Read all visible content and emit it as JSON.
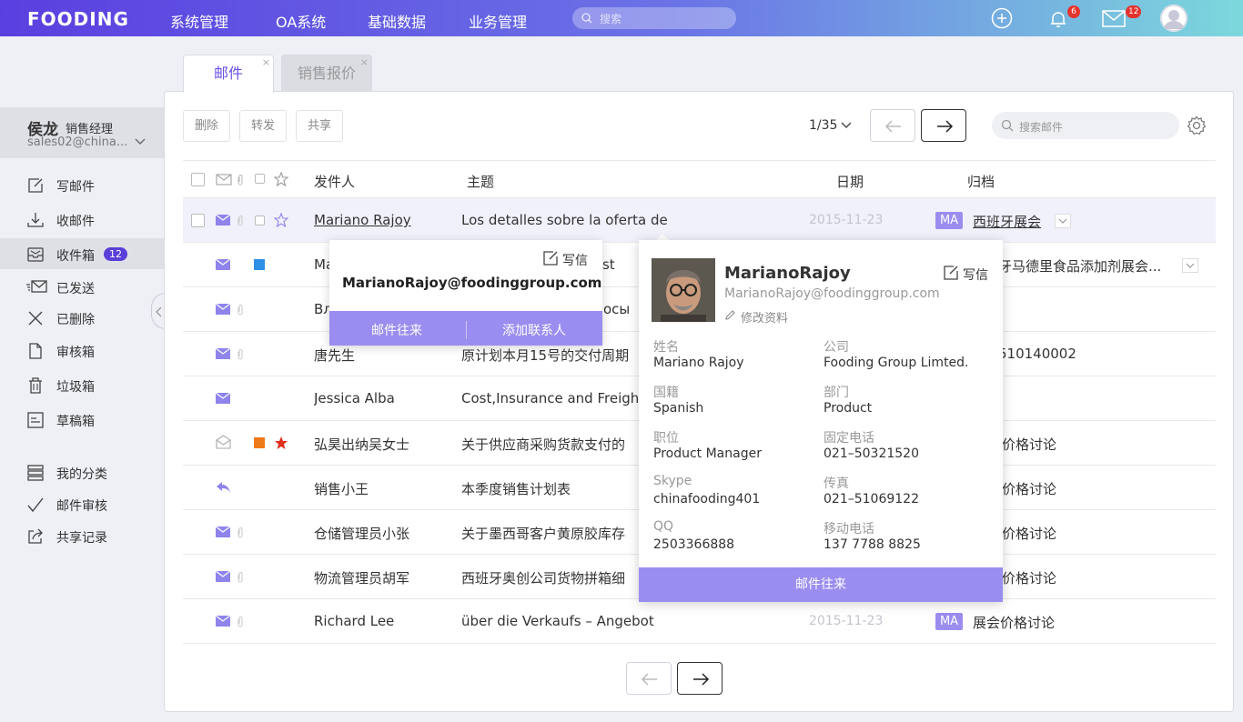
{
  "app": {
    "logo": "FOODING",
    "nav": [
      "系统管理",
      "OA系统",
      "基础数据",
      "业务管理"
    ],
    "search_placeholder": "搜索",
    "notifications_count": "6",
    "mail_count": "12"
  },
  "tabs": [
    {
      "label": "邮件",
      "active": true
    },
    {
      "label": "销售报价",
      "active": false
    }
  ],
  "user": {
    "name": "侯龙",
    "role": "销售经理",
    "email": "sales02@china..."
  },
  "sidebar": {
    "items": [
      {
        "label": "写邮件",
        "icon": "compose-icon"
      },
      {
        "label": "收邮件",
        "icon": "download-icon"
      },
      {
        "label": "收件箱",
        "icon": "inbox-icon",
        "badge": "12"
      },
      {
        "label": "已发送",
        "icon": "sent-icon"
      },
      {
        "label": "已删除",
        "icon": "close-icon"
      },
      {
        "label": "审核箱",
        "icon": "document-icon"
      },
      {
        "label": "垃圾箱",
        "icon": "trash-icon"
      },
      {
        "label": "草稿箱",
        "icon": "draft-icon"
      },
      {
        "label": "我的分类",
        "icon": "stack-icon"
      },
      {
        "label": "邮件审核",
        "icon": "check-icon"
      },
      {
        "label": "共享记录",
        "icon": "share-icon"
      }
    ]
  },
  "toolbar": {
    "delete": "删除",
    "forward": "转发",
    "share": "共享",
    "page": "1/35",
    "search_placeholder": "搜索邮件"
  },
  "table": {
    "headers": {
      "sender": "发件人",
      "subject": "主题",
      "date": "日期",
      "archive": "归档"
    },
    "rows": [
      {
        "sender": "Mariano Rajoy",
        "subject": "Los detalles sobre la oferta de",
        "date": "2015-11-23",
        "tag": "MA",
        "archive": "西班牙展会"
      },
      {
        "sender": "Ma",
        "subject": "cuest",
        "date": "",
        "tag": "",
        "archive": "牙马德里食品添加剂展会..."
      },
      {
        "sender": "Вл",
        "subject": "осы",
        "date": "",
        "tag": "",
        "archive": ""
      },
      {
        "sender": "唐先生",
        "subject": "原计划本月15号的交付周期",
        "date": "",
        "tag": "",
        "archive": "510140002"
      },
      {
        "sender": "Jessica Alba",
        "subject": "Cost,Insurance and Freigh",
        "date": "",
        "tag": "",
        "archive": ""
      },
      {
        "sender": "弘昊出纳吴女士",
        "subject": "关于供应商采购货款支付的",
        "date": "",
        "tag": "",
        "archive": "价格讨论"
      },
      {
        "sender": "销售小王",
        "subject": "本季度销售计划表",
        "date": "",
        "tag": "",
        "archive": "价格讨论"
      },
      {
        "sender": "仓储管理员小张",
        "subject": "关于墨西哥客户黄原胶库存",
        "date": "",
        "tag": "",
        "archive": "价格讨论"
      },
      {
        "sender": "物流管理员胡军",
        "subject": "西班牙奥创公司货物拼箱细",
        "date": "",
        "tag": "",
        "archive": "价格讨论"
      },
      {
        "sender": "Richard Lee",
        "subject": "über die Verkaufs – Angebot",
        "date": "2015-11-23",
        "tag": "MA",
        "archive": "展会价格讨论"
      }
    ]
  },
  "popup_small": {
    "write": "写信",
    "email": "MarianoRajoy@foodinggroup.com",
    "btn_history": "邮件往来",
    "btn_add": "添加联系人"
  },
  "popup_card": {
    "name": "MarianoRajoy",
    "email": "MarianoRajoy@foodinggroup.com",
    "edit": "修改资料",
    "write": "写信",
    "fields": [
      {
        "label": "姓名",
        "value": "Mariano Rajoy"
      },
      {
        "label": "公司",
        "value": "Fooding Group Limted."
      },
      {
        "label": "国籍",
        "value": "Spanish"
      },
      {
        "label": "部门",
        "value": "Product"
      },
      {
        "label": "职位",
        "value": "Product Manager"
      },
      {
        "label": "固定电话",
        "value": "021–50321520"
      },
      {
        "label": "Skype",
        "value": "chinafooding401"
      },
      {
        "label": "传真",
        "value": "021–51069122"
      },
      {
        "label": "QQ",
        "value": "2503366888"
      },
      {
        "label": "移动电话",
        "value": "137 7788 8825"
      }
    ],
    "btn_history": "邮件往来"
  },
  "colors": {
    "accent": "#5b3fd8",
    "tag": "#9b8df0",
    "flag_blue": "#2d8fe5",
    "flag_orange": "#ee7a1a",
    "star_red": "#e0301e"
  }
}
